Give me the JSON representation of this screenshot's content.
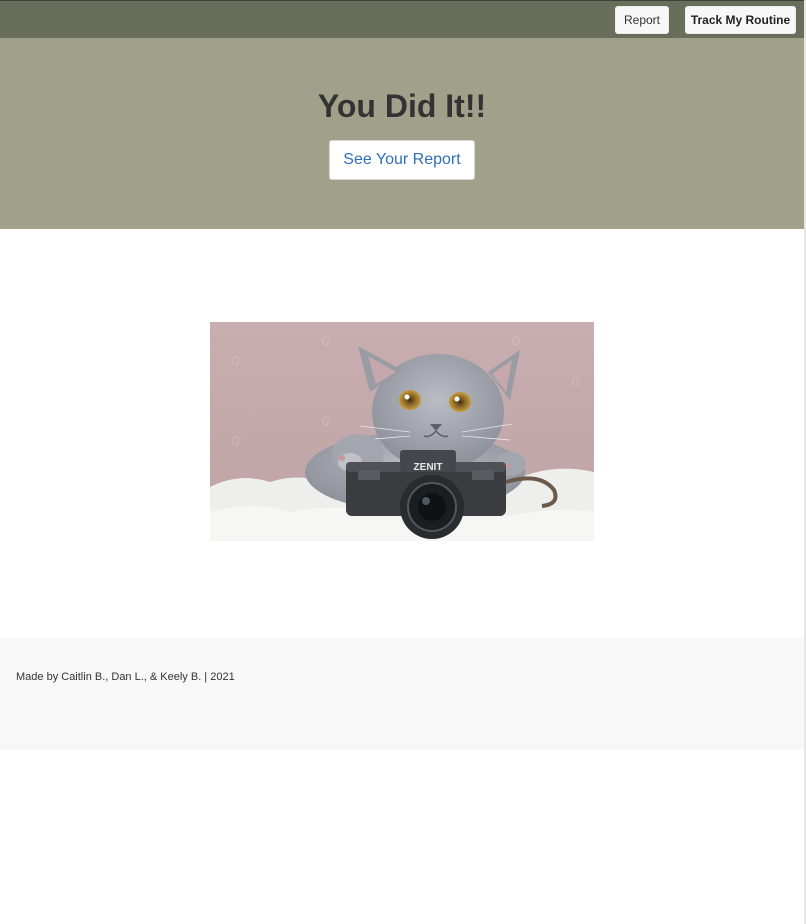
{
  "nav": {
    "report_label": "Report",
    "track_label": "Track My Routine"
  },
  "hero": {
    "title": "You Did It!!",
    "button_label": "See Your Report"
  },
  "photo": {
    "camera_brand": "ZENIT"
  },
  "footer": {
    "credit": "Made by Caitlin B., Dan L., & Keely B. | 2021"
  },
  "colors": {
    "topbar": "#686e5a",
    "hero_bg": "#a1a18b",
    "link_blue": "#2f6fb8",
    "footer_bg": "#f8f8f8"
  }
}
